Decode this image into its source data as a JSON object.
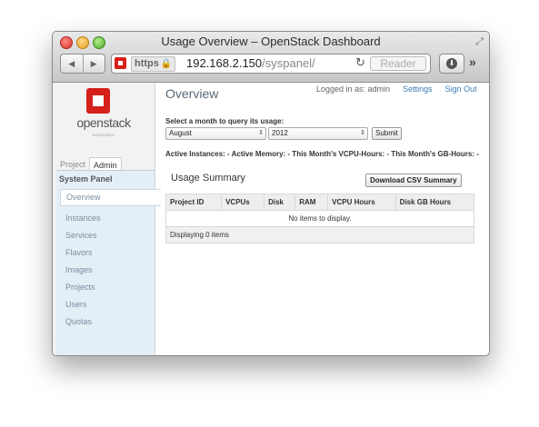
{
  "window": {
    "title": "Usage Overview – OpenStack Dashboard",
    "url_scheme": "https",
    "url_host": "192.168.2.150",
    "url_path": "/syspanel/",
    "reader_label": "Reader",
    "more_label": "»"
  },
  "sidebar": {
    "logo_text": "openstack",
    "logo_sub": "RACKSPACE",
    "tabs": [
      "Project",
      "Admin"
    ],
    "panel_title": "System Panel",
    "items": [
      "Overview",
      "Instances",
      "Services",
      "Flavors",
      "Images",
      "Projects",
      "Users",
      "Quotas"
    ]
  },
  "header": {
    "page_title": "Overview",
    "logged_in": "Logged in as: admin",
    "settings": "Settings",
    "signout": "Sign Out"
  },
  "query": {
    "label": "Select a month to query its usage:",
    "month": "August",
    "year": "2012",
    "submit": "Submit"
  },
  "summary_text": "Active Instances: - Active Memory: - This Month's VCPU-Hours: - This Month's GB-Hours: -",
  "usage": {
    "title": "Usage Summary",
    "csv_button": "Download CSV Summary",
    "columns": [
      "Project ID",
      "VCPUs",
      "Disk",
      "RAM",
      "VCPU Hours",
      "Disk GB Hours"
    ],
    "empty_text": "No items to display.",
    "footer": "Displaying 0 items"
  }
}
